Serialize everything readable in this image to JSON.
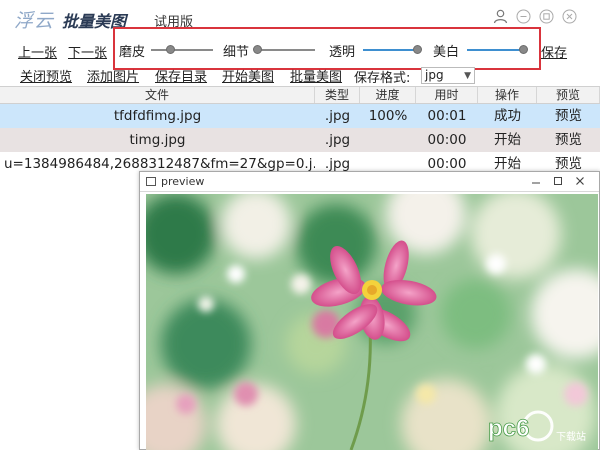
{
  "app": {
    "logo_text": "浮云",
    "title": "批量美图",
    "edition": "试用版"
  },
  "toolbar": {
    "prev": "上一张",
    "next": "下一张",
    "save": "保存",
    "close_preview": "关闭预览",
    "add_image": "添加图片",
    "save_dir": "保存目录",
    "start_beautify": "开始美图",
    "batch_beautify": "批量美图",
    "format_label": "保存格式:",
    "format_value": "jpg"
  },
  "sliders": [
    {
      "label": "磨皮",
      "value": 0.3
    },
    {
      "label": "细节",
      "value": 0.0
    },
    {
      "label": "透明",
      "value": 1.0
    },
    {
      "label": "美白",
      "value": 1.0
    }
  ],
  "table": {
    "headers": [
      "文件",
      "类型",
      "进度",
      "用时",
      "操作",
      "预览"
    ],
    "rows": [
      {
        "file": "tfdfdfimg.jpg",
        "type": ".jpg",
        "progress": "100%",
        "time": "00:01",
        "op": "成功",
        "preview": "预览"
      },
      {
        "file": "timg.jpg",
        "type": ".jpg",
        "progress": "",
        "time": "00:00",
        "op": "开始",
        "preview": "预览"
      },
      {
        "file": "u=1384986484,2688312487&fm=27&gp=0.j...",
        "type": ".jpg",
        "progress": "",
        "time": "00:00",
        "op": "开始",
        "preview": "预览"
      }
    ]
  },
  "preview_window": {
    "title": "preview"
  },
  "watermark": {
    "text": "pc6",
    "subtext": "下载站"
  },
  "colors": {
    "accent": "#3e8fd0",
    "highlight_border": "#d9343c",
    "selected_row": "#cce6fb",
    "alt_row": "#e8e2e2",
    "flower": "#e0609a"
  },
  "icons": {
    "user": "user-icon",
    "minimize": "minimize-icon",
    "restore": "restore-icon",
    "close": "close-icon"
  }
}
